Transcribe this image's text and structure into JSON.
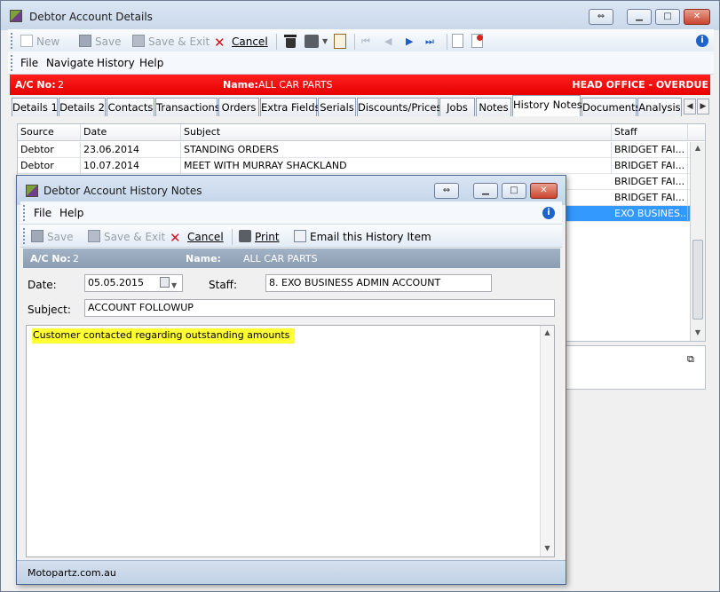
{
  "main_window": {
    "title": "Debtor Account Details",
    "toolbar": {
      "new_label": "New",
      "save_label": "Save",
      "save_exit_label": "Save & Exit",
      "cancel_label": "Cancel"
    },
    "menu": [
      "File",
      "Navigate",
      "History",
      "Help"
    ],
    "header": {
      "ac_label": "A/C No:",
      "ac_value": "2",
      "name_label": "Name:",
      "name_value": "ALL CAR PARTS",
      "right_text": "HEAD OFFICE - OVERDUE"
    },
    "tabs": [
      "Details 1",
      "Details 2",
      "Contacts",
      "Transactions",
      "Orders",
      "Extra Fields",
      "Serials",
      "Discounts/Prices",
      "Jobs",
      "Notes",
      "History Notes",
      "Documents",
      "Analysis"
    ],
    "active_tab": "History Notes",
    "grid": {
      "columns": [
        "Source",
        "Date",
        "Subject",
        "Staff"
      ],
      "rows": [
        {
          "source": "Debtor",
          "date": "23.06.2014",
          "subject": "STANDING ORDERS",
          "staff": "BRIDGET FAI..."
        },
        {
          "source": "Debtor",
          "date": "10.07.2014",
          "subject": "MEET WITH MURRAY SHACKLAND",
          "staff": "BRIDGET FAI..."
        },
        {
          "source": "",
          "date": "",
          "subject": "",
          "staff": "BRIDGET FAI..."
        },
        {
          "source": "",
          "date": "",
          "subject": "",
          "staff": "BRIDGET FAI..."
        },
        {
          "source": "",
          "date": "",
          "subject": "",
          "staff": "EXO BUSINES..."
        }
      ]
    }
  },
  "dialog": {
    "title": "Debtor Account History Notes",
    "menu": [
      "File",
      "Help"
    ],
    "toolbar": {
      "save_label": "Save",
      "save_exit_label": "Save & Exit",
      "cancel_label": "Cancel",
      "print_label": "Print",
      "email_label": "Email this History Item"
    },
    "header": {
      "ac_label": "A/C No:",
      "ac_value": "2",
      "name_label": "Name:",
      "name_value": "ALL CAR PARTS"
    },
    "form": {
      "date_label": "Date:",
      "date_value": "05.05.2015",
      "staff_label": "Staff:",
      "staff_value": "8. EXO BUSINESS ADMIN ACCOUNT",
      "subject_label": "Subject:",
      "subject_value": "ACCOUNT FOLLOWUP",
      "note_text": "Customer contacted regarding outstanding amounts"
    },
    "status_text": "Motopartz.com.au"
  },
  "colors": {
    "header_red": "#ff1a1a",
    "highlight_yellow": "#ffff33",
    "selected_row": "#3399ff"
  }
}
